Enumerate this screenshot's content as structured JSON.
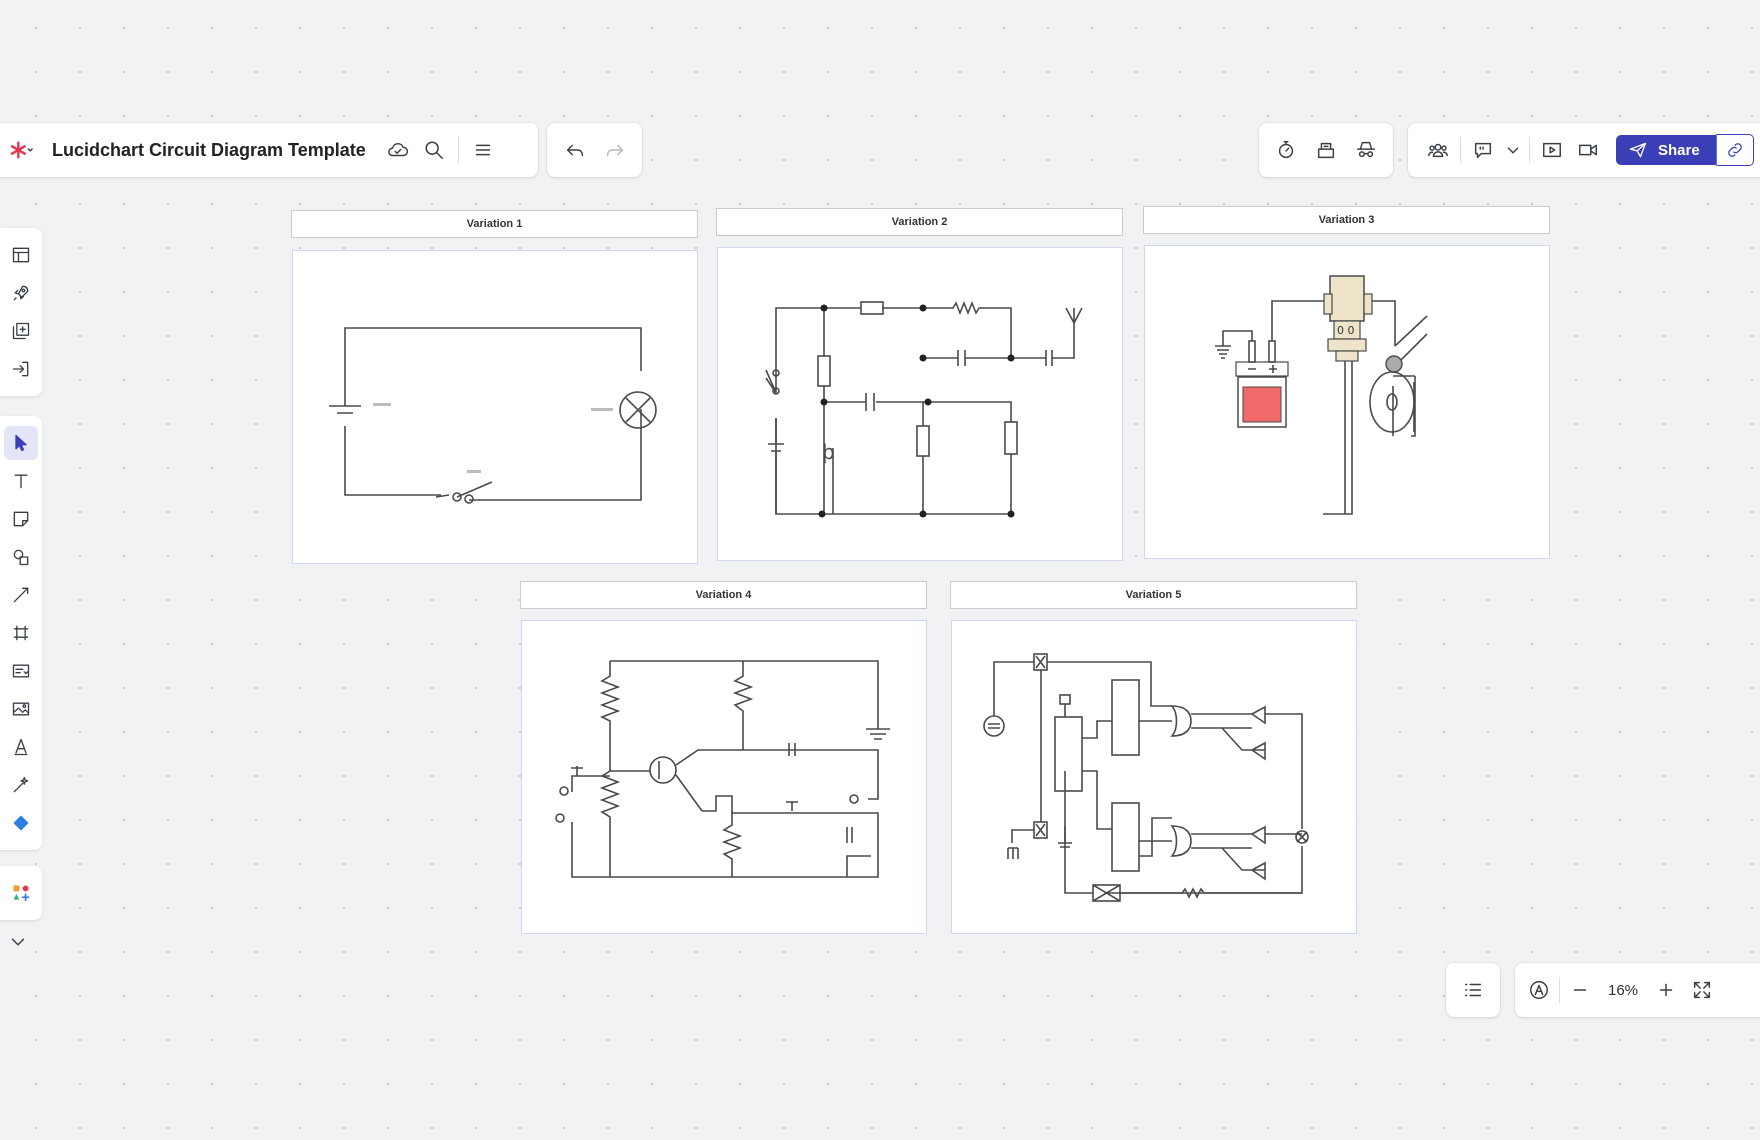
{
  "app": {
    "logo": "lucid-asterisk-icon",
    "title": "Lucidchart Circuit Diagram Template"
  },
  "toolbar": {
    "share_label": "Share"
  },
  "variations": [
    {
      "label": "Variation 1"
    },
    {
      "label": "Variation 2"
    },
    {
      "label": "Variation 3"
    },
    {
      "label": "Variation 4"
    },
    {
      "label": "Variation 5"
    }
  ],
  "zoom": {
    "level": "16%"
  },
  "colors": {
    "accent": "#3b3fb6",
    "logo": "#e8334a",
    "component_fill": "#ede4c9",
    "red_fill": "#f26b6b"
  }
}
